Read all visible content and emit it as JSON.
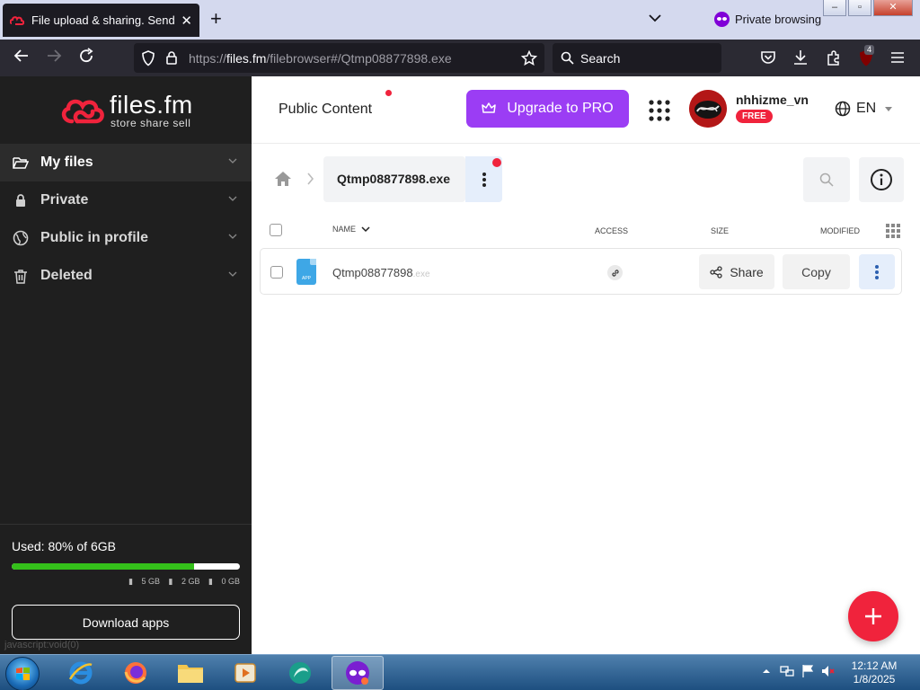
{
  "browser": {
    "tab_title": "File upload & sharing. Send large files",
    "new_tab_label": "+",
    "private_label": "Private browsing",
    "url_prefix": "https://",
    "url_host": "files.fm",
    "url_path": "/filebrowser#/Qtmp08877898.exe",
    "search_placeholder": "Search",
    "extension_badge": "4"
  },
  "sidebar": {
    "brand_name": "files.fm",
    "brand_tagline": "store share sell",
    "items": [
      {
        "label": "My files",
        "icon": "folder-open-icon",
        "active": true
      },
      {
        "label": "Private",
        "icon": "lock-icon",
        "active": false
      },
      {
        "label": "Public in profile",
        "icon": "globe-icon",
        "active": false
      },
      {
        "label": "Deleted",
        "icon": "trash-icon",
        "active": false
      }
    ],
    "storage": {
      "used_label": "Used: 80% of 6GB",
      "used_fraction": 0.8,
      "legend": [
        "5 GB",
        "2 GB",
        "0 GB"
      ]
    },
    "download_apps_label": "Download apps",
    "status_link": "javascript:void(0)"
  },
  "header": {
    "public_content_label": "Public Content",
    "upgrade_label": "Upgrade to PRO",
    "username": "nhhizme_vn",
    "plan_badge": "FREE",
    "language": "EN"
  },
  "breadcrumb": {
    "current": "Qtmp08877898.exe"
  },
  "table": {
    "columns": [
      "NAME",
      "ACCESS",
      "SIZE",
      "MODIFIED"
    ],
    "rows": [
      {
        "file_icon_label": "APP",
        "name": "Qtmp08877898",
        "extension": ".exe",
        "share_label": "Share",
        "copy_label": "Copy"
      }
    ]
  },
  "taskbar": {
    "time": "12:12 AM",
    "date": "1/8/2025"
  },
  "colors": {
    "accent_purple": "#9b3df4",
    "brand_red": "#f0233c",
    "storage_green": "#34c01a",
    "sidebar_bg": "#1f1f1f"
  }
}
